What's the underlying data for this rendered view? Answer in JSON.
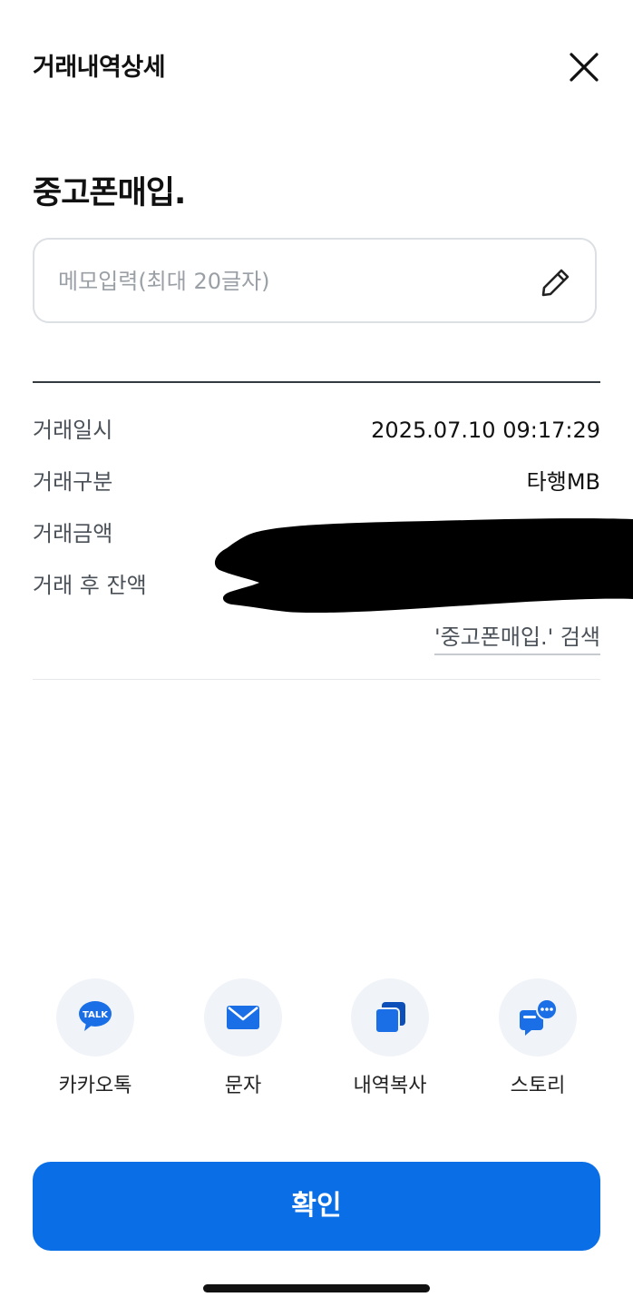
{
  "header": {
    "title": "거래내역상세"
  },
  "merchant": {
    "name": "중고폰매입."
  },
  "memo": {
    "placeholder": "메모입력(최대 20글자)",
    "value": ""
  },
  "details": [
    {
      "label": "거래일시",
      "value": "2025.07.10 09:17:29"
    },
    {
      "label": "거래구분",
      "value": "타행MB"
    },
    {
      "label": "거래금액",
      "value": ""
    },
    {
      "label": "거래 후 잔액",
      "value": ""
    }
  ],
  "search_link": "'중고폰매입.' 검색",
  "share": [
    {
      "label": "카카오톡",
      "icon": "kakaotalk-icon"
    },
    {
      "label": "문자",
      "icon": "envelope-icon"
    },
    {
      "label": "내역복사",
      "icon": "copy-icon"
    },
    {
      "label": "스토리",
      "icon": "story-chat-icon"
    }
  ],
  "talk_badge": "TALK",
  "confirm_label": "확인",
  "colors": {
    "primary": "#0a6ee6",
    "icon_bg": "#f0f3f8",
    "label": "#4b5158",
    "redaction": "#000000"
  }
}
